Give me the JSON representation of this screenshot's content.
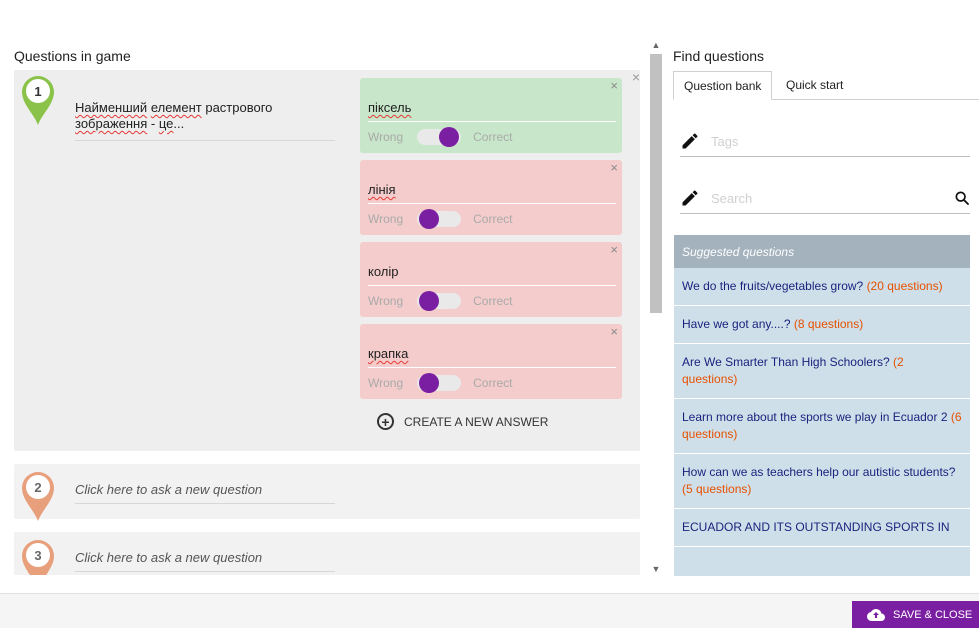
{
  "left": {
    "title": "Questions in game",
    "active_question": {
      "number": "1",
      "text_a": "Найменший",
      "text_b": " ",
      "text_c": "елемент",
      "text_d": " растрового ",
      "text_e": "зображення",
      "text_f": " - ",
      "text_g": "це",
      "text_h": "...",
      "close": "×"
    },
    "answers": [
      {
        "text": "піксель",
        "wrong_label": "Wrong",
        "correct_label": "Correct",
        "state": "correct",
        "close": "×"
      },
      {
        "text": "лінія",
        "wrong_label": "Wrong",
        "correct_label": "Correct",
        "state": "wrong",
        "close": "×"
      },
      {
        "text": "колір",
        "wrong_label": "Wrong",
        "correct_label": "Correct",
        "state": "wrong",
        "close": "×"
      },
      {
        "text": "крапка",
        "wrong_label": "Wrong",
        "correct_label": "Correct",
        "state": "wrong",
        "close": "×"
      }
    ],
    "create_answer_label": "CREATE A NEW ANSWER",
    "new_questions": [
      {
        "number": "2",
        "placeholder": "Click here to ask a new question"
      },
      {
        "number": "3",
        "placeholder": "Click here to ask a new question"
      }
    ]
  },
  "right": {
    "title": "Find questions",
    "tabs": [
      "Question bank",
      "Quick start"
    ],
    "tags_placeholder": "Tags",
    "search_placeholder": "Search",
    "suggested_header": "Suggested questions",
    "suggested": [
      {
        "title": "We do the fruits/vegetables grow?",
        "count": "(20 questions)"
      },
      {
        "title": "Have we got any....?",
        "count": "(8 questions)"
      },
      {
        "title": "Are We Smarter Than High Schoolers?",
        "count": "(2 questions)"
      },
      {
        "title": "Learn more about the sports we play in Ecuador 2",
        "count": "(6 questions)"
      },
      {
        "title": "How can we as teachers help our autistic students?",
        "count": "(5 questions)"
      },
      {
        "title": "ECUADOR AND ITS OUTSTANDING SPORTS IN",
        "count": ""
      }
    ]
  },
  "footer": {
    "save_label": "SAVE & CLOSE"
  },
  "colors": {
    "accent": "#7b1fa2",
    "correct_bg": "#c8e6c9",
    "wrong_bg": "#f4cccc",
    "pin_active": "#8bc34a",
    "pin_inactive": "#e8a07c",
    "count_text": "#e65100"
  },
  "icons": {
    "pin": "map-pin-icon",
    "close": "close-icon",
    "plus": "plus-circle-icon",
    "pencil": "pencil-icon",
    "search": "search-icon",
    "upload": "cloud-upload-icon"
  }
}
